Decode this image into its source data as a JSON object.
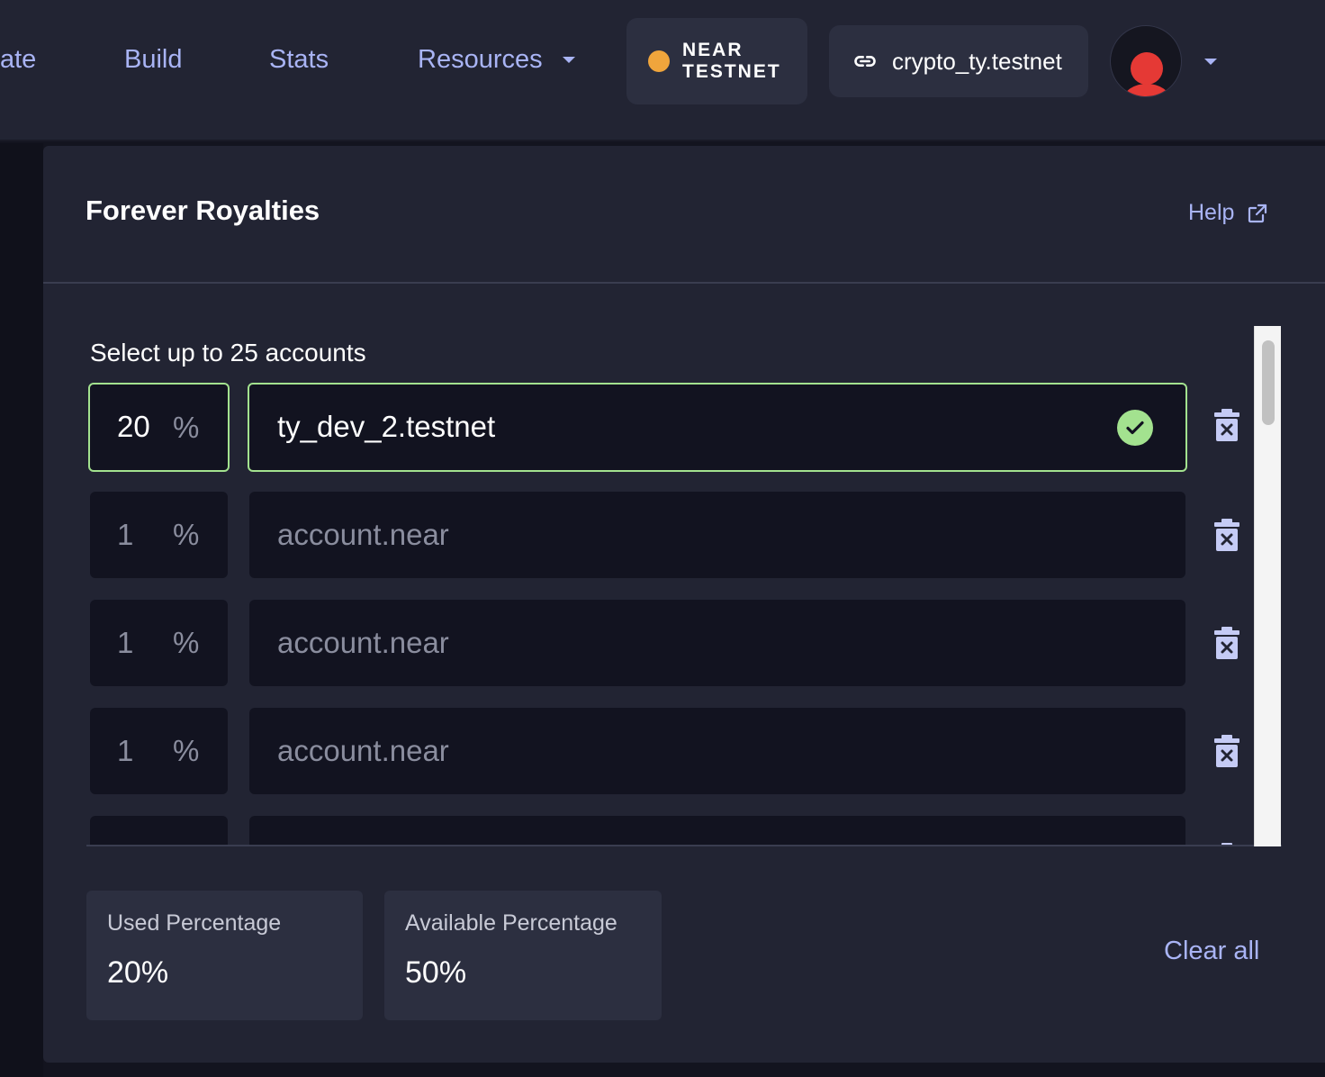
{
  "nav": {
    "items": [
      {
        "label": "ate"
      },
      {
        "label": "Build"
      },
      {
        "label": "Stats"
      },
      {
        "label": "Resources"
      }
    ],
    "network": {
      "label_line1": "NEAR",
      "label_line2": "TESTNET",
      "dot_color": "#f0a53c"
    },
    "account": {
      "label": "crypto_ty.testnet"
    }
  },
  "panel": {
    "title": "Forever Royalties",
    "help_label": "Help",
    "select_label": "Select up to 25 accounts",
    "rows": [
      {
        "percent": "20",
        "percent_symbol": "%",
        "account": "ty_dev_2.testnet",
        "valid": true
      },
      {
        "percent": "1",
        "percent_symbol": "%",
        "account": "account.near",
        "valid": false
      },
      {
        "percent": "1",
        "percent_symbol": "%",
        "account": "account.near",
        "valid": false
      },
      {
        "percent": "1",
        "percent_symbol": "%",
        "account": "account.near",
        "valid": false
      }
    ],
    "used": {
      "label": "Used Percentage",
      "value": "20%"
    },
    "available": {
      "label": "Available Percentage",
      "value": "50%"
    },
    "clear_all_label": "Clear all"
  },
  "colors": {
    "accent_link": "#a9b4f5",
    "valid_green": "#a3e28f",
    "panel_bg": "#222433",
    "input_bg": "#121320"
  }
}
